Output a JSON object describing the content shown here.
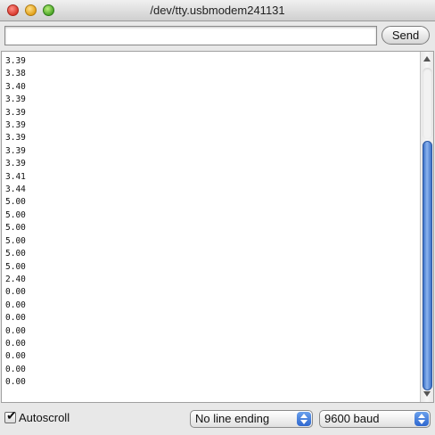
{
  "window": {
    "title": "/dev/tty.usbmodem241131",
    "controls": [
      "close-icon",
      "minimize-icon",
      "zoom-icon"
    ]
  },
  "toolbar": {
    "input_value": "",
    "send_label": "Send"
  },
  "output": {
    "lines": [
      "3.39",
      "3.38",
      "3.40",
      "3.39",
      "3.39",
      "3.39",
      "3.39",
      "3.39",
      "3.39",
      "3.41",
      "3.44",
      "5.00",
      "5.00",
      "5.00",
      "5.00",
      "5.00",
      "5.00",
      "2.40",
      "0.00",
      "0.00",
      "0.00",
      "0.00",
      "0.00",
      "0.00",
      "0.00",
      "0.00"
    ],
    "text": "3.39\n3.38\n3.40\n3.39\n3.39\n3.39\n3.39\n3.39\n3.39\n3.41\n3.44\n5.00\n5.00\n5.00\n5.00\n5.00\n5.00\n2.40\n0.00\n0.00\n0.00\n0.00\n0.00\n0.00\n0.00\n0.00"
  },
  "statusbar": {
    "autoscroll_label": "Autoscroll",
    "autoscroll_checked": true,
    "line_ending": "No line ending",
    "baud_rate": "9600 baud"
  },
  "colors": {
    "scroll_thumb": "#3d72c9",
    "stepper": "#2e67cf"
  }
}
